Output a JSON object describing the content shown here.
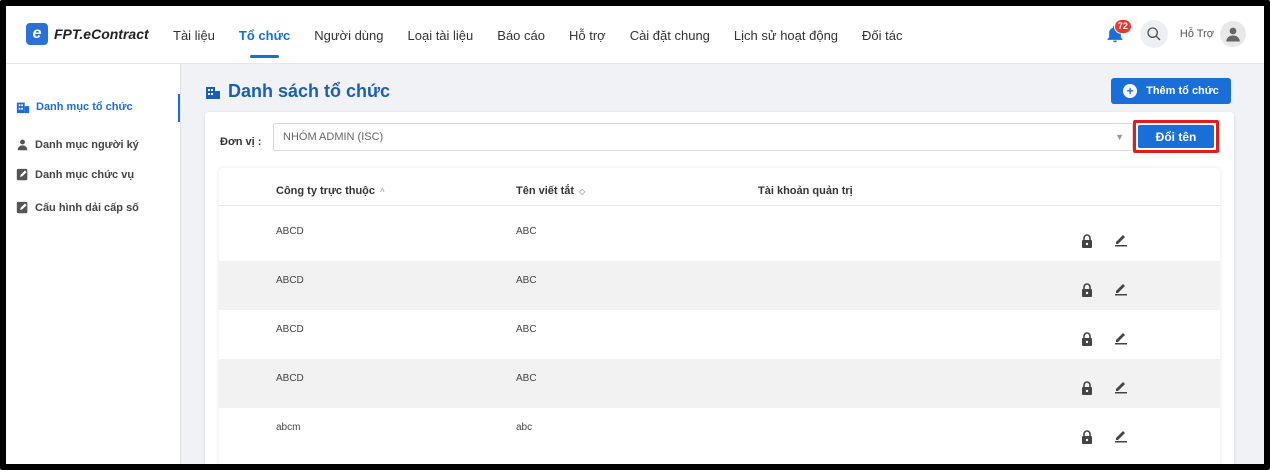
{
  "app": {
    "logo_text": "FPT.eContract"
  },
  "nav": [
    "Tài liệu",
    "Tổ chức",
    "Người dùng",
    "Loại tài liệu",
    "Báo cáo",
    "Hỗ trợ",
    "Cài đặt chung",
    "Lịch sử hoạt động",
    "Đối tác"
  ],
  "nav_active": "Tổ chức",
  "header": {
    "notification_count": "72",
    "user_label": "Hỗ Trợ"
  },
  "sidebar": {
    "items": [
      {
        "label": "Danh mục tổ chức",
        "icon": "building-icon",
        "active": true
      },
      {
        "label": "Danh mục người ký",
        "icon": "user-icon",
        "active": false
      },
      {
        "label": "Danh mục chức vụ",
        "icon": "edit-doc-icon",
        "active": false
      },
      {
        "label": "Cấu hình dải cấp số",
        "icon": "edit-doc-icon",
        "active": false
      }
    ]
  },
  "main": {
    "title": "Danh sách tổ chức",
    "add_button": "Thêm tổ chức",
    "unit_label": "Đơn vị :",
    "unit_value": "NHÓM ADMIN (ISC)",
    "rename_button": "Đổi tên"
  },
  "table": {
    "columns": [
      "Công ty trực thuộc",
      "Tên viết tắt",
      "Tài khoản quản trị"
    ],
    "rows": [
      [
        "ABCD",
        "ABC",
        ""
      ],
      [
        "ABCD",
        "ABC",
        ""
      ],
      [
        "ABCD",
        "ABC",
        ""
      ],
      [
        "ABCD",
        "ABC",
        ""
      ],
      [
        "abcm",
        "abc",
        ""
      ]
    ]
  },
  "colors": {
    "primary": "#1a6ed8",
    "highlight_border": "#e31d1d",
    "badge": "#e53935"
  }
}
